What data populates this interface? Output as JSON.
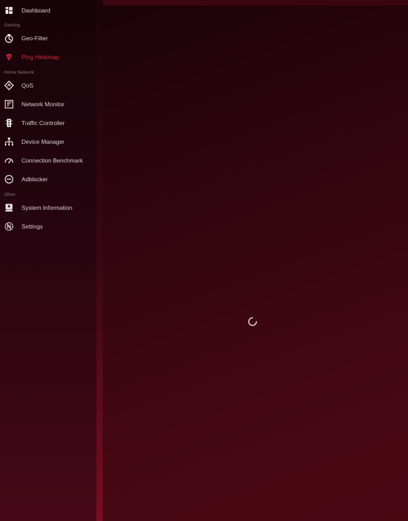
{
  "sidebar": {
    "items": [
      {
        "label": "Dashboard",
        "icon": "dashboard-icon"
      },
      {
        "label": "Geo-Filter",
        "icon": "geo-filter-icon"
      },
      {
        "label": "Ping Heatmap",
        "icon": "fingerprint-icon",
        "active": true
      },
      {
        "label": "QoS",
        "icon": "qos-icon"
      },
      {
        "label": "Network Monitor",
        "icon": "network-monitor-icon"
      },
      {
        "label": "Traffic Controller",
        "icon": "traffic-light-icon"
      },
      {
        "label": "Device Manager",
        "icon": "device-tree-icon"
      },
      {
        "label": "Connection Benchmark",
        "icon": "speedometer-icon"
      },
      {
        "label": "Adblocker",
        "icon": "block-icon"
      },
      {
        "label": "System Information",
        "icon": "system-info-icon"
      },
      {
        "label": "Settings",
        "icon": "settings-icon"
      }
    ],
    "sections": {
      "gaming": "Gaming",
      "home_network": "Home Network",
      "other": "Other"
    }
  },
  "colors": {
    "accent": "#d32a3a",
    "text": "#d8d2d4",
    "section_text": "#8a7479"
  },
  "main": {
    "loading": true
  }
}
